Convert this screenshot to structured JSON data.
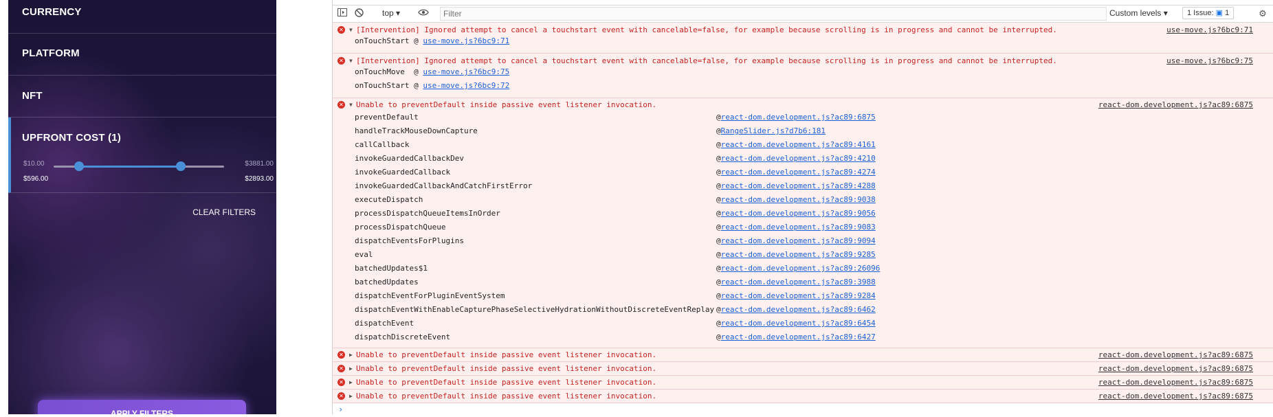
{
  "filters": {
    "currency": "CURRENCY",
    "platform": "PLATFORM",
    "nft": "NFT",
    "upfront_cost": "UPFRONT COST",
    "upfront_count": "(1)",
    "range_min": "$10.00",
    "range_max": "$3881.00",
    "selected_min": "$596.00",
    "selected_max": "$2893.00",
    "slider_low_fraction": 0.15,
    "slider_high_fraction": 0.745,
    "clear_filters": "CLEAR FILTERS",
    "apply_filters": "APPLY FILTERS"
  },
  "toolbar": {
    "context": "top",
    "filter_placeholder": "Filter",
    "levels": "Custom levels",
    "issues_label": "1 Issue:",
    "issues_count": "1"
  },
  "console": {
    "intervention_message": "[Intervention] Ignored attempt to cancel a touchstart event with cancelable=false, for example because scrolling is in progress and cannot be interrupted.",
    "entry1_source": "use-move.js?6bc9:71",
    "entry1_frame_name": "onTouchStart",
    "entry1_frame_link": "use-move.js?6bc9:71",
    "entry2_source": "use-move.js?6bc9:75",
    "entry2_frame1_name": "onTouchMove",
    "entry2_frame1_link": "use-move.js?6bc9:75",
    "entry2_frame2_name": "onTouchStart",
    "entry2_frame2_link": "use-move.js?6bc9:72",
    "passive_message": "Unable to preventDefault inside passive event listener invocation.",
    "passive_source": "react-dom.development.js?ac89:6875",
    "stack": [
      {
        "name": "preventDefault",
        "link": "react-dom.development.js?ac89:6875"
      },
      {
        "name": "handleTrackMouseDownCapture",
        "link": "RangeSlider.js?d7b6:181"
      },
      {
        "name": "callCallback",
        "link": "react-dom.development.js?ac89:4161"
      },
      {
        "name": "invokeGuardedCallbackDev",
        "link": "react-dom.development.js?ac89:4210"
      },
      {
        "name": "invokeGuardedCallback",
        "link": "react-dom.development.js?ac89:4274"
      },
      {
        "name": "invokeGuardedCallbackAndCatchFirstError",
        "link": "react-dom.development.js?ac89:4288"
      },
      {
        "name": "executeDispatch",
        "link": "react-dom.development.js?ac89:9038"
      },
      {
        "name": "processDispatchQueueItemsInOrder",
        "link": "react-dom.development.js?ac89:9056"
      },
      {
        "name": "processDispatchQueue",
        "link": "react-dom.development.js?ac89:9083"
      },
      {
        "name": "dispatchEventsForPlugins",
        "link": "react-dom.development.js?ac89:9094"
      },
      {
        "name": "eval",
        "link": "react-dom.development.js?ac89:9285"
      },
      {
        "name": "batchedUpdates$1",
        "link": "react-dom.development.js?ac89:26096"
      },
      {
        "name": "batchedUpdates",
        "link": "react-dom.development.js?ac89:3988"
      },
      {
        "name": "dispatchEventForPluginEventSystem",
        "link": "react-dom.development.js?ac89:9284"
      },
      {
        "name": "dispatchEventWithEnableCapturePhaseSelectiveHydrationWithoutDiscreteEventReplay",
        "link": "react-dom.development.js?ac89:6462"
      },
      {
        "name": "dispatchEvent",
        "link": "react-dom.development.js?ac89:6454"
      },
      {
        "name": "dispatchDiscreteEvent",
        "link": "react-dom.development.js?ac89:6427"
      }
    ],
    "collapsed_entries": [
      {
        "message": "Unable to preventDefault inside passive event listener invocation.",
        "source": "react-dom.development.js?ac89:6875"
      },
      {
        "message": "Unable to preventDefault inside passive event listener invocation.",
        "source": "react-dom.development.js?ac89:6875"
      },
      {
        "message": "Unable to preventDefault inside passive event listener invocation.",
        "source": "react-dom.development.js?ac89:6875"
      },
      {
        "message": "Unable to preventDefault inside passive event listener invocation.",
        "source": "react-dom.development.js?ac89:6875"
      }
    ],
    "prompt": "›"
  },
  "colors": {
    "error_text": "#c5221f",
    "error_bg": "#fff0f0",
    "accent": "#4a90d9"
  }
}
